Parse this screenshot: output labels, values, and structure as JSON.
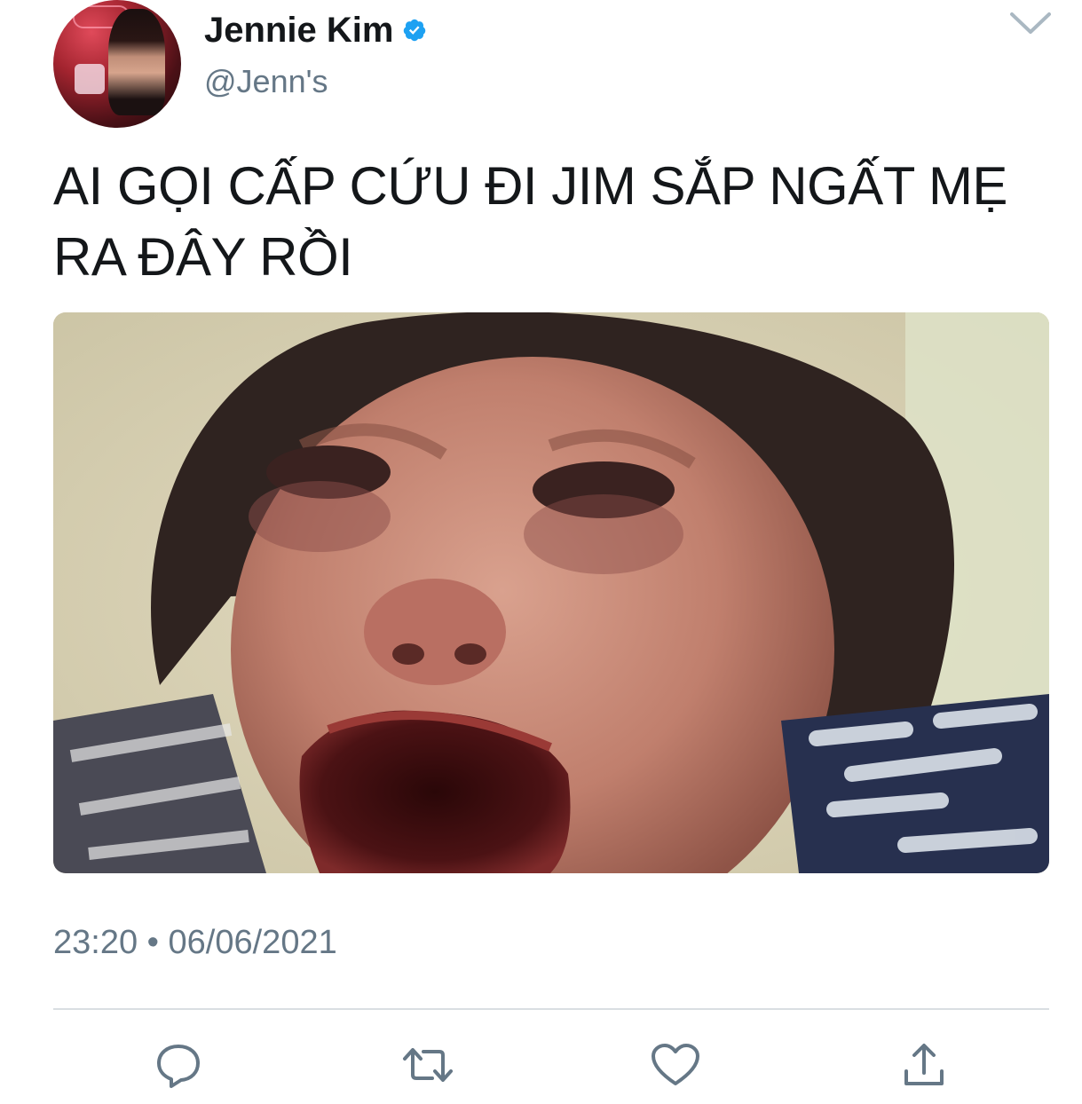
{
  "author": {
    "display_name": "Jennie Kim",
    "handle": "@Jenn's",
    "verified": true,
    "avatar_icon": "avatar-photo"
  },
  "tweet": {
    "text": "AI GỌI CẤP CỨU ĐI JIM SẮP NGẤT MẸ RA ĐÂY RỒI",
    "media_description_icon": "photo-media",
    "time": "23:20",
    "separator": "•",
    "date": "06/06/2021"
  },
  "icons": {
    "more": "chevron-down-icon",
    "verified": "verified-badge-icon",
    "reply": "reply-icon",
    "retweet": "retweet-icon",
    "like": "like-heart-icon",
    "share": "share-icon"
  },
  "colors": {
    "text_primary": "#14171a",
    "text_secondary": "#657786",
    "verified_blue": "#1da1f2",
    "icon_gray": "#657786",
    "divider": "#d9dee2"
  }
}
